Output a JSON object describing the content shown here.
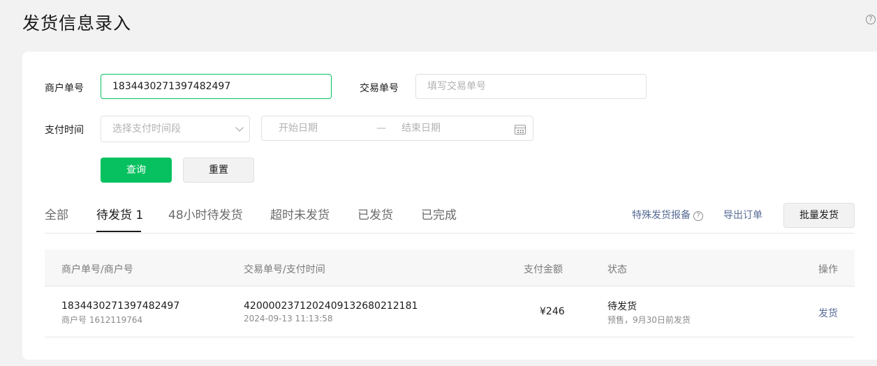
{
  "header": {
    "title": "发货信息录入",
    "help_icon": "?"
  },
  "form": {
    "merchant_order_label": "商户单号",
    "merchant_order_value": "1834430271397482497",
    "transaction_label": "交易单号",
    "transaction_placeholder": "填写交易单号",
    "pay_time_label": "支付时间",
    "pay_time_select_placeholder": "选择支付时间段",
    "start_date_placeholder": "开始日期",
    "date_separator": "—",
    "end_date_placeholder": "结束日期",
    "query_button": "查询",
    "reset_button": "重置"
  },
  "tabs": [
    {
      "label": "全部",
      "active": false
    },
    {
      "label": "待发货 1",
      "active": true
    },
    {
      "label": "48小时待发货",
      "active": false
    },
    {
      "label": "超时未发货",
      "active": false
    },
    {
      "label": "已发货",
      "active": false
    },
    {
      "label": "已完成",
      "active": false
    }
  ],
  "actions": {
    "special_report": "特殊发货报备",
    "export_orders": "导出订单",
    "batch_ship": "批量发货"
  },
  "table": {
    "columns": [
      "商户单号/商户号",
      "交易单号/支付时间",
      "支付金额",
      "状态",
      "操作"
    ],
    "rows": [
      {
        "merchant_order": "1834430271397482497",
        "merchant_id": "商户号 1612119764",
        "transaction_id": "4200002371202409132680212181",
        "pay_time": "2024-09-13 11:13:58",
        "amount": "¥246",
        "status": "待发货",
        "status_note": "预售，9月30日前发货",
        "action": "发货"
      }
    ]
  },
  "colors": {
    "accent": "#07c160",
    "link": "#576b95",
    "background": "#f2f2f2"
  }
}
